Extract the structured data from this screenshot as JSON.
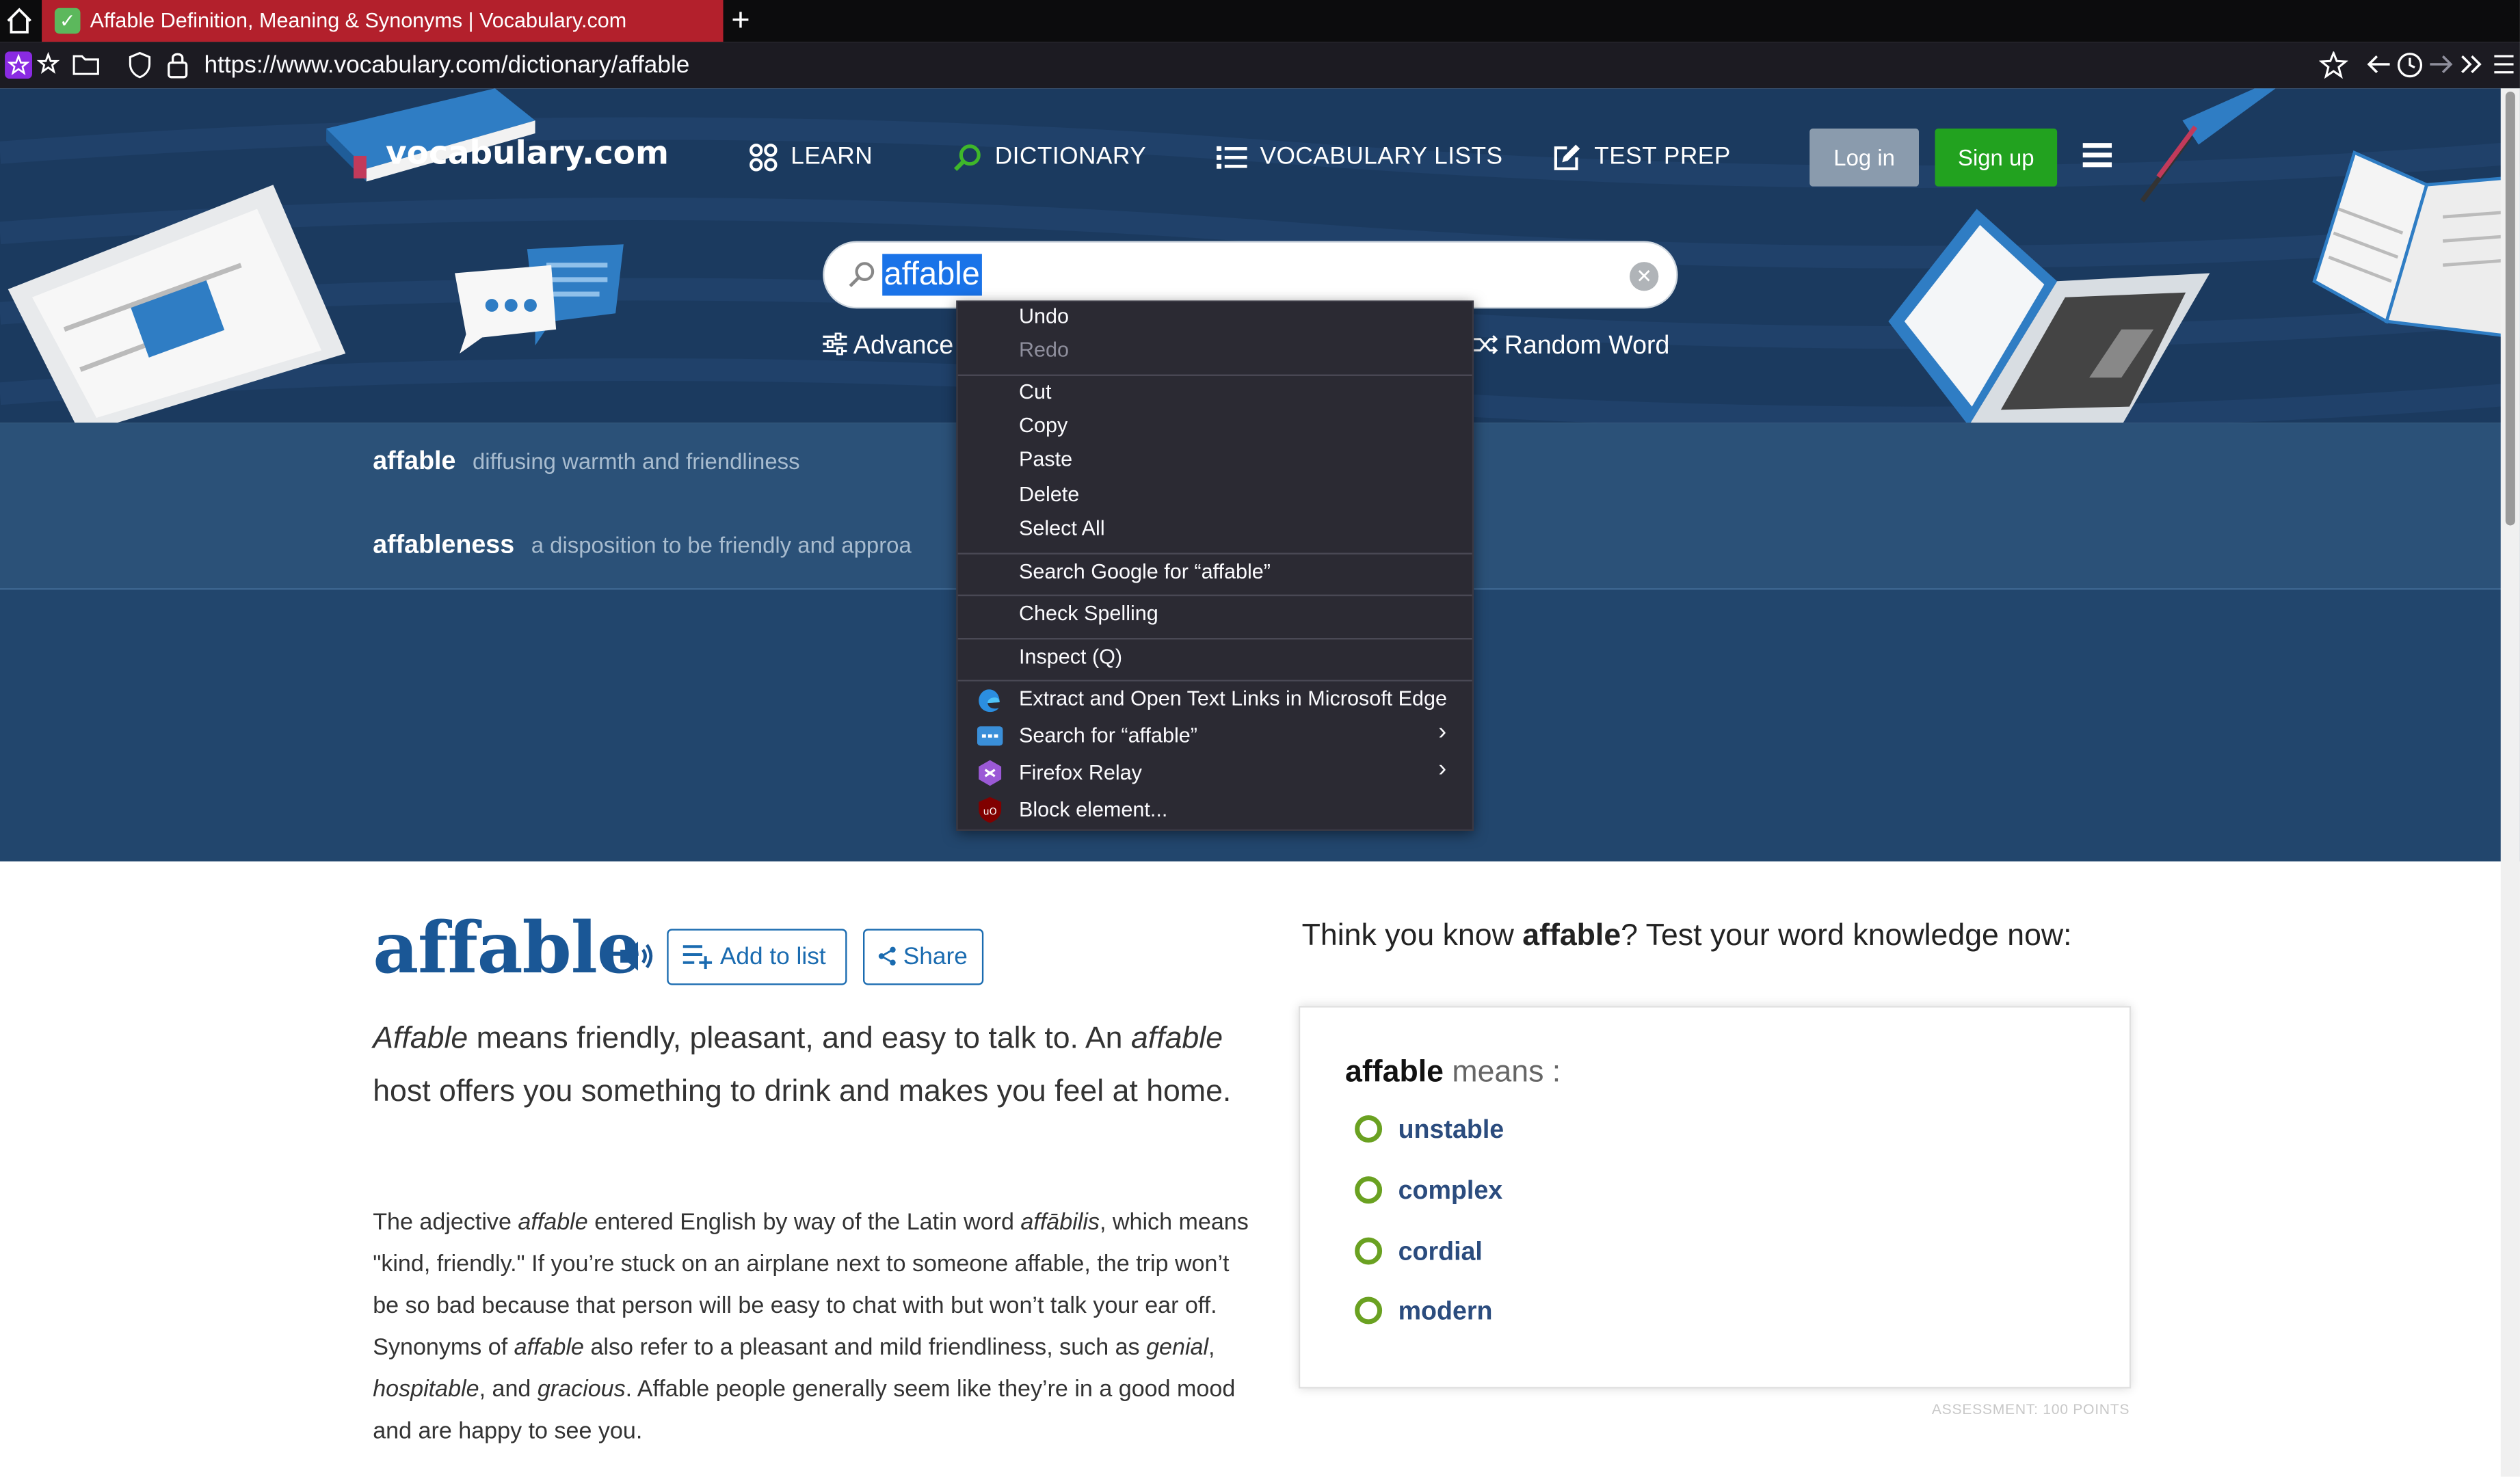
{
  "browser": {
    "tab_title": "Affable Definition, Meaning & Synonyms | Vocabulary.com",
    "new_tab_label": "+",
    "url": "https://www.vocabulary.com/dictionary/affable"
  },
  "header": {
    "logo_text": "vocabulary.com",
    "nav": [
      {
        "label": "LEARN",
        "icon": "grid-icon"
      },
      {
        "label": "DICTIONARY",
        "icon": "search-icon"
      },
      {
        "label": "VOCABULARY LISTS",
        "icon": "list-icon"
      },
      {
        "label": "TEST PREP",
        "icon": "pencil-icon"
      }
    ],
    "login_label": "Log in",
    "signup_label": "Sign up",
    "accent_green": "#22a21f",
    "bg_color": "#1b3a5f"
  },
  "search": {
    "value": "affable",
    "advanced_label": "Advance",
    "random_label": "Random Word"
  },
  "suggestions": [
    {
      "word": "affable",
      "definition": "diffusing warmth and friendliness"
    },
    {
      "word": "affableness",
      "definition": "a disposition to be friendly and approa"
    }
  ],
  "context_menu": {
    "items": [
      {
        "label": "Undo",
        "disabled": false
      },
      {
        "label": "Redo",
        "disabled": true
      },
      {
        "label": "Cut",
        "disabled": false
      },
      {
        "label": "Copy",
        "disabled": false
      },
      {
        "label": "Paste",
        "disabled": false
      },
      {
        "label": "Delete",
        "disabled": false
      },
      {
        "label": "Select All",
        "disabled": false
      },
      {
        "label": "Search Google for “affable”",
        "disabled": false
      },
      {
        "label": "Check Spelling",
        "disabled": false
      },
      {
        "label": "Inspect (Q)",
        "disabled": false
      },
      {
        "label": "Extract and Open Text Links in Microsoft Edge",
        "icon": "edge-icon"
      },
      {
        "label": "Search for “affable”",
        "icon": "search-ext-icon",
        "submenu": true
      },
      {
        "label": "Firefox Relay",
        "icon": "relay-icon",
        "submenu": true
      },
      {
        "label": "Block element...",
        "icon": "ublock-icon"
      }
    ]
  },
  "entry": {
    "word": "affable",
    "add_to_list_label": "Add to list",
    "share_label": "Share",
    "short_def": {
      "w1": "Affable",
      "t1": " means friendly, pleasant, and easy to talk to. An ",
      "w2": "affable",
      "t2": " host offers you something to drink and makes you feel at home."
    },
    "long_def": {
      "p1": "The adjective ",
      "i1": "affable",
      "p2": " entered English by way of the Latin word ",
      "i2": "affābilis",
      "p3": ", which means \"kind, friendly.\" If you’re stuck on an airplane next to someone affable, the trip won’t be so bad because that person will be easy to chat with but won’t talk your ear off. Synonyms of ",
      "i3": "affable",
      "p4": " also refer to a pleasant and mild friendliness, such as ",
      "i4": "genial",
      "p5": ", ",
      "i5": "hospitable",
      "p6": ", and ",
      "i6": "gracious",
      "p7": ". Affable people generally seem like they’re in a good mood and are happy to see you."
    }
  },
  "quiz": {
    "prompt_pre": "Think you know ",
    "prompt_word": "affable",
    "prompt_post": "? Test your word knowledge now:",
    "question_word": "affable",
    "question_rest": " means :",
    "options": [
      "unstable",
      "complex",
      "cordial",
      "modern"
    ],
    "assessment": "ASSESSMENT: 100 POINTS"
  }
}
